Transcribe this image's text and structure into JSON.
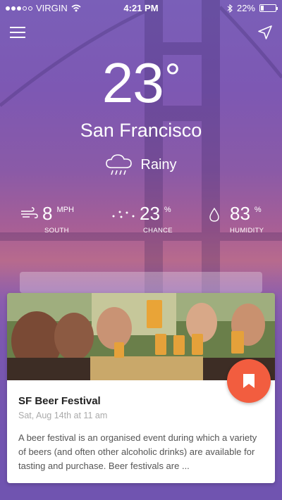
{
  "status_bar": {
    "carrier": "VIRGIN",
    "time": "4:21 PM",
    "battery": "22%",
    "battery_level": 0.22
  },
  "weather": {
    "temperature": "23",
    "degree_symbol": "°",
    "city": "San Francisco",
    "condition": "Rainy",
    "stats": [
      {
        "value": "8",
        "unit": "MPH",
        "label": "SOUTH",
        "icon": "wind-icon"
      },
      {
        "value": "23",
        "unit": "%",
        "label": "CHANCE",
        "icon": "rain-drops-icon"
      },
      {
        "value": "83",
        "unit": "%",
        "label": "HUMIDITY",
        "icon": "droplet-icon"
      }
    ]
  },
  "event": {
    "title": "SF Beer Festival",
    "date": "Sat, Aug 14th at 11 am",
    "description": "A beer festival is an organised event during which a variety of beers (and often other alcoholic drinks) are available for tasting and purchase. Beer festivals are ..."
  },
  "colors": {
    "accent": "#f25d3f",
    "background_top": "#7a5fb8",
    "background_mid": "#b76a8d"
  }
}
